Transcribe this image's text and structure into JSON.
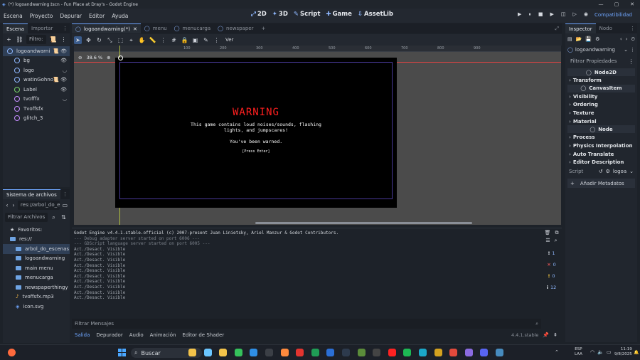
{
  "window": {
    "title": "(*) logoandwarning.tscn - Fun Place at Dray's - Godot Engine",
    "controls": [
      "—",
      "▢",
      "✕"
    ]
  },
  "menus": [
    "Escena",
    "Proyecto",
    "Depurar",
    "Editor",
    "Ayuda"
  ],
  "main_screens": [
    {
      "icon": "⤢",
      "label": "2D"
    },
    {
      "icon": "✦",
      "label": "3D"
    },
    {
      "icon": "✎",
      "label": "Script"
    },
    {
      "icon": "✚",
      "label": "Game"
    },
    {
      "icon": "⇩",
      "label": "AssetLib"
    }
  ],
  "run_controls": [
    "▶",
    "⏸",
    "■",
    "▶",
    "◫",
    "▷",
    "◉"
  ],
  "renderer": "Compatibilidad",
  "scene_dock": {
    "tabs": [
      "Escena",
      "Importar"
    ],
    "filter_placeholder": "Filtro:",
    "nodes": [
      {
        "name": "logoandwarni",
        "color": "#8fb8ff",
        "depth": 0,
        "right": "📜 👁",
        "selected": true
      },
      {
        "name": "bg",
        "color": "#8fb8ff",
        "depth": 1,
        "right": "👁"
      },
      {
        "name": "logo",
        "color": "#8fb8ff",
        "depth": 1,
        "right": "◡"
      },
      {
        "name": "watinGohno",
        "color": "#8fb8ff",
        "depth": 1,
        "right": "📜 👁"
      },
      {
        "name": "Label",
        "color": "#79d26b",
        "depth": 1,
        "right": "👁"
      },
      {
        "name": "tvofffx",
        "color": "#c58cff",
        "depth": 1,
        "right": "◡"
      },
      {
        "name": "Tvoffsfx",
        "color": "#c58cff",
        "depth": 1,
        "right": ""
      },
      {
        "name": "glitch_3",
        "color": "#c58cff",
        "depth": 1,
        "right": ""
      }
    ]
  },
  "filesystem": {
    "title": "Sistema de archivos",
    "path": "res://arbol_do_e",
    "filter_placeholder": "Filtrar Archivos",
    "favorites": "Favoritos:",
    "items": [
      {
        "name": "res://",
        "depth": 0,
        "type": "folder"
      },
      {
        "name": "arbol_do_escenas",
        "depth": 1,
        "type": "folder",
        "selected": true
      },
      {
        "name": "logoandwarning",
        "depth": 1,
        "type": "folder"
      },
      {
        "name": "main menu",
        "depth": 1,
        "type": "folder"
      },
      {
        "name": "menucarga",
        "depth": 1,
        "type": "folder"
      },
      {
        "name": "newspaperthingy",
        "depth": 1,
        "type": "folder"
      },
      {
        "name": "tvoffsfx.mp3",
        "depth": 1,
        "type": "audio"
      },
      {
        "name": "icon.svg",
        "depth": 1,
        "type": "image"
      }
    ]
  },
  "editor_tabs": [
    {
      "label": "logoandwarning(*)",
      "active": true,
      "closable": true
    },
    {
      "label": "menu",
      "active": false
    },
    {
      "label": "menucarga",
      "active": false
    },
    {
      "label": "newspaper",
      "active": false
    }
  ],
  "add_tab": "+",
  "toolbar": {
    "view_menu": "Ver"
  },
  "viewport": {
    "zoom": "38.6 %",
    "ruler": [
      "100",
      "200",
      "300",
      "400",
      "500",
      "600",
      "700",
      "800",
      "900"
    ]
  },
  "game_screen": {
    "title": "WARNING",
    "line1": "This game contains loud noises/sounds, flashing",
    "line2": "lights, and jumpscares!",
    "line3": "You've been warned.",
    "line4": "[Press Enter]"
  },
  "output": {
    "lines": [
      {
        "text": "Godot Engine v4.4.1.stable.official (c) 2007-present Juan Linietsky, Ariel Manzur & Godot Contributors.",
        "dim": false
      },
      {
        "text": "--- Debug adapter server started on port 6006 ---",
        "dim": true
      },
      {
        "text": "--- GDScript language server started on port 6005 ---",
        "dim": true
      },
      {
        "text": "Act./Desact. Visible",
        "dim": false
      },
      {
        "text": "Act./Desact. Visible",
        "dim": false
      },
      {
        "text": "Act./Desact. Visible",
        "dim": false
      },
      {
        "text": "Act./Desact. Visible",
        "dim": false
      },
      {
        "text": "Act./Desact. Visible",
        "dim": false
      },
      {
        "text": "Act./Desact. Visible",
        "dim": false
      },
      {
        "text": "Act./Desact. Visible",
        "dim": false
      },
      {
        "text": "Act./Desact. Visible",
        "dim": false
      },
      {
        "text": "Act./Desact. Visible",
        "dim": false
      },
      {
        "text": "Act./Desact. Visible",
        "dim": false
      }
    ],
    "filter_placeholder": "Filtrar Mensajes",
    "counters": [
      {
        "icon": "!",
        "color": "#e9eef5",
        "count": "1"
      },
      {
        "icon": "✕",
        "color": "#ff5d5d",
        "count": "0"
      },
      {
        "icon": "!",
        "color": "#ffd042",
        "count": "0"
      },
      {
        "icon": "i",
        "color": "#e9eef5",
        "count": "12"
      }
    ]
  },
  "bottom_tabs": [
    "Salida",
    "Depurador",
    "Audio",
    "Animación",
    "Editor de Shader"
  ],
  "version": "4.4.1.stable",
  "inspector": {
    "tabs": [
      "Inspector",
      "Nodo"
    ],
    "object": "logoandwarning",
    "filter_placeholder": "Filtrar Propiedades",
    "sections": [
      {
        "label": "Node2D",
        "kind": "header"
      },
      {
        "label": "Transform",
        "kind": "section"
      },
      {
        "label": "CanvasItem",
        "kind": "header"
      },
      {
        "label": "Visibility",
        "kind": "section"
      },
      {
        "label": "Ordering",
        "kind": "section"
      },
      {
        "label": "Texture",
        "kind": "section"
      },
      {
        "label": "Material",
        "kind": "section"
      },
      {
        "label": "Node",
        "kind": "header"
      },
      {
        "label": "Process",
        "kind": "section"
      },
      {
        "label": "Physics Interpolation",
        "kind": "section"
      },
      {
        "label": "Auto Translate",
        "kind": "section"
      },
      {
        "label": "Editor Description",
        "kind": "section"
      }
    ],
    "script_label": "Script",
    "script_value": "logoa",
    "add_metadata": "Añadir Metadatos"
  },
  "taskbar": {
    "search": "Buscar",
    "lang": "ESP",
    "lang2": "LAA",
    "time": "11:19",
    "date": "9/8/2025",
    "icons": [
      {
        "name": "file-explorer-icon",
        "color": "#f3c34a"
      },
      {
        "name": "copilot-icon",
        "color": "#6bc6ff"
      },
      {
        "name": "folder-icon",
        "color": "#f3c34a"
      },
      {
        "name": "whatsapp-icon",
        "color": "#35c25b"
      },
      {
        "name": "vscode-icon",
        "color": "#2f8fe6"
      },
      {
        "name": "terminal-icon",
        "color": "#3b3f46"
      },
      {
        "name": "paint-icon",
        "color": "#ff8a3d"
      },
      {
        "name": "opera-icon",
        "color": "#e3342f"
      },
      {
        "name": "excel-icon",
        "color": "#1f9d55"
      },
      {
        "name": "word-icon",
        "color": "#2b6fd6"
      },
      {
        "name": "steam-icon",
        "color": "#2d3a4d"
      },
      {
        "name": "minecraft-icon",
        "color": "#5b8c3a"
      },
      {
        "name": "obs-icon",
        "color": "#444"
      },
      {
        "name": "youtube-icon",
        "color": "#ff2222"
      },
      {
        "name": "spotify-icon",
        "color": "#1db954"
      },
      {
        "name": "edge-icon",
        "color": "#1ba8c9"
      },
      {
        "name": "fallout-icon",
        "color": "#d4a21f"
      },
      {
        "name": "chrome-icon",
        "color": "#e34a3c"
      },
      {
        "name": "photos-icon",
        "color": "#8b6be0"
      },
      {
        "name": "discord-icon",
        "color": "#5865f2"
      },
      {
        "name": "godot-icon",
        "color": "#478cbf"
      }
    ]
  },
  "colors": {
    "accent": "#6fa6ff",
    "warning_red": "#ff1f1f"
  }
}
